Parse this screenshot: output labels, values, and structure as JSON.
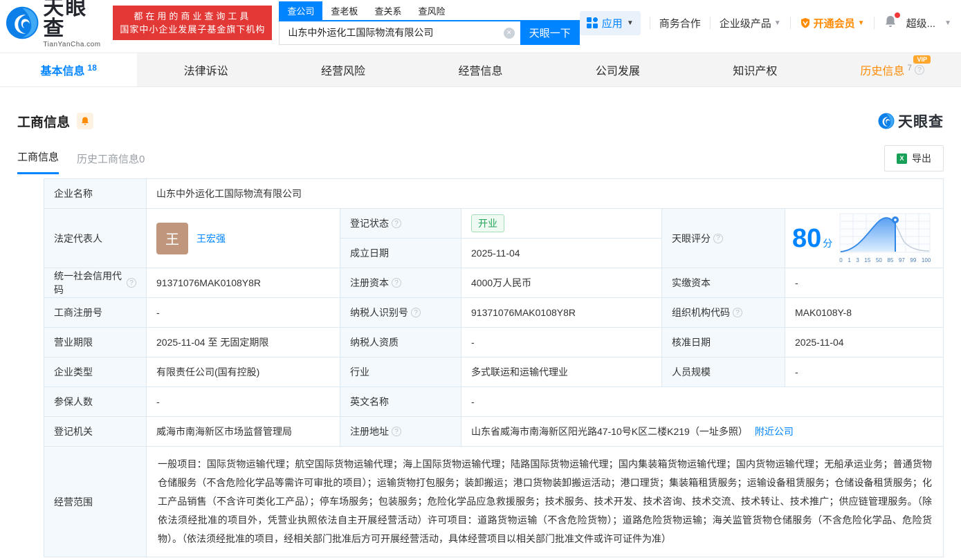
{
  "header": {
    "logo": {
      "cn": "天眼查",
      "en": "TianYanCha.com"
    },
    "promo": {
      "line1": "都在用的商业查询工具",
      "line2": "国家中小企业发展子基金旗下机构"
    },
    "search": {
      "tabs": [
        {
          "label": "查公司"
        },
        {
          "label": "查老板"
        },
        {
          "label": "查关系"
        },
        {
          "label": "查风险"
        }
      ],
      "value": "山东中外运化工国际物流有限公司",
      "button": "天眼一下"
    },
    "nav": {
      "apps": "应用",
      "business": "商务合作",
      "enterprise": "企业级产品",
      "vip": "开通会员",
      "user": "超级..."
    }
  },
  "tabs": [
    {
      "label": "基本信息",
      "count": "18"
    },
    {
      "label": "法律诉讼"
    },
    {
      "label": "经营风险"
    },
    {
      "label": "经营信息"
    },
    {
      "label": "公司发展"
    },
    {
      "label": "知识产权"
    },
    {
      "label": "历史信息",
      "count": "7",
      "vip": "VIP"
    }
  ],
  "section": {
    "title": "工商信息",
    "watermark": "天眼查",
    "export": "导出",
    "subtabs": [
      {
        "label": "工商信息"
      },
      {
        "label": "历史工商信息0"
      }
    ]
  },
  "table": {
    "name": {
      "label": "企业名称",
      "value": "山东中外运化工国际物流有限公司"
    },
    "legal": {
      "label": "法定代表人",
      "avatar_char": "王",
      "name": "王宏强"
    },
    "status": {
      "label": "登记状态",
      "value": "开业"
    },
    "established": {
      "label": "成立日期",
      "value": "2025-11-04"
    },
    "score": {
      "label": "天眼评分",
      "value": "80",
      "unit": "分",
      "ticks": [
        "0",
        "1",
        "3",
        "15",
        "50",
        "85",
        "97",
        "99",
        "100"
      ]
    },
    "credit_code": {
      "label": "统一社会信用代码",
      "value": "91371076MAK0108Y8R"
    },
    "reg_capital": {
      "label": "注册资本",
      "value": "4000万人民币"
    },
    "paid_capital": {
      "label": "实缴资本",
      "value": "-"
    },
    "reg_number": {
      "label": "工商注册号",
      "value": "-"
    },
    "taxpayer_id": {
      "label": "纳税人识别号",
      "value": "91371076MAK0108Y8R"
    },
    "org_code": {
      "label": "组织机构代码",
      "value": "MAK0108Y-8"
    },
    "business_term": {
      "label": "营业期限",
      "value": "2025-11-04 至 无固定期限"
    },
    "taxpayer_quality": {
      "label": "纳税人资质",
      "value": "-"
    },
    "approval_date": {
      "label": "核准日期",
      "value": "2025-11-04"
    },
    "company_type": {
      "label": "企业类型",
      "value": "有限责任公司(国有控股)"
    },
    "industry": {
      "label": "行业",
      "value": "多式联运和运输代理业"
    },
    "staff_size": {
      "label": "人员规模",
      "value": "-"
    },
    "insured_count": {
      "label": "参保人数",
      "value": "-"
    },
    "english_name": {
      "label": "英文名称",
      "value": "-"
    },
    "reg_authority": {
      "label": "登记机关",
      "value": "威海市南海新区市场监督管理局"
    },
    "reg_address": {
      "label": "注册地址",
      "value": "山东省威海市南海新区阳光路47-10号K区二楼K219（一址多照）",
      "link": "附近公司"
    },
    "business_scope": {
      "label": "经营范围",
      "value": "一般项目：国际货物运输代理；航空国际货物运输代理；海上国际货物运输代理；陆路国际货物运输代理；国内集装箱货物运输代理；国内货物运输代理；无船承运业务；普通货物仓储服务（不含危险化学品等需许可审批的项目）；运输货物打包服务；装卸搬运；港口货物装卸搬运活动；港口理货；集装箱租赁服务；运输设备租赁服务；仓储设备租赁服务；化工产品销售（不含许可类化工产品）；停车场服务；包装服务；危险化学品应急救援服务；技术服务、技术开发、技术咨询、技术交流、技术转让、技术推广；供应链管理服务。（除依法须经批准的项目外，凭营业执照依法自主开展经营活动）许可项目：道路货物运输（不含危险货物）；道路危险货物运输；海关监管货物仓储服务（不含危险化学品、危险货物）。（依法须经批准的项目，经相关部门批准后方可开展经营活动，具体经营项目以相关部门批准文件或许可证件为准）"
    }
  },
  "chart_data": {
    "type": "area",
    "title": "天眼评分分布",
    "x_ticks": [
      "0",
      "1",
      "3",
      "15",
      "50",
      "85",
      "97",
      "99",
      "100"
    ],
    "marker_value": 85,
    "score": 80
  },
  "colors": {
    "brand_blue": "#0084ff",
    "promo_red": "#e23836",
    "vip_orange": "#ff8a00",
    "open_green": "#23a757",
    "label_bg": "#f3f9fd"
  }
}
